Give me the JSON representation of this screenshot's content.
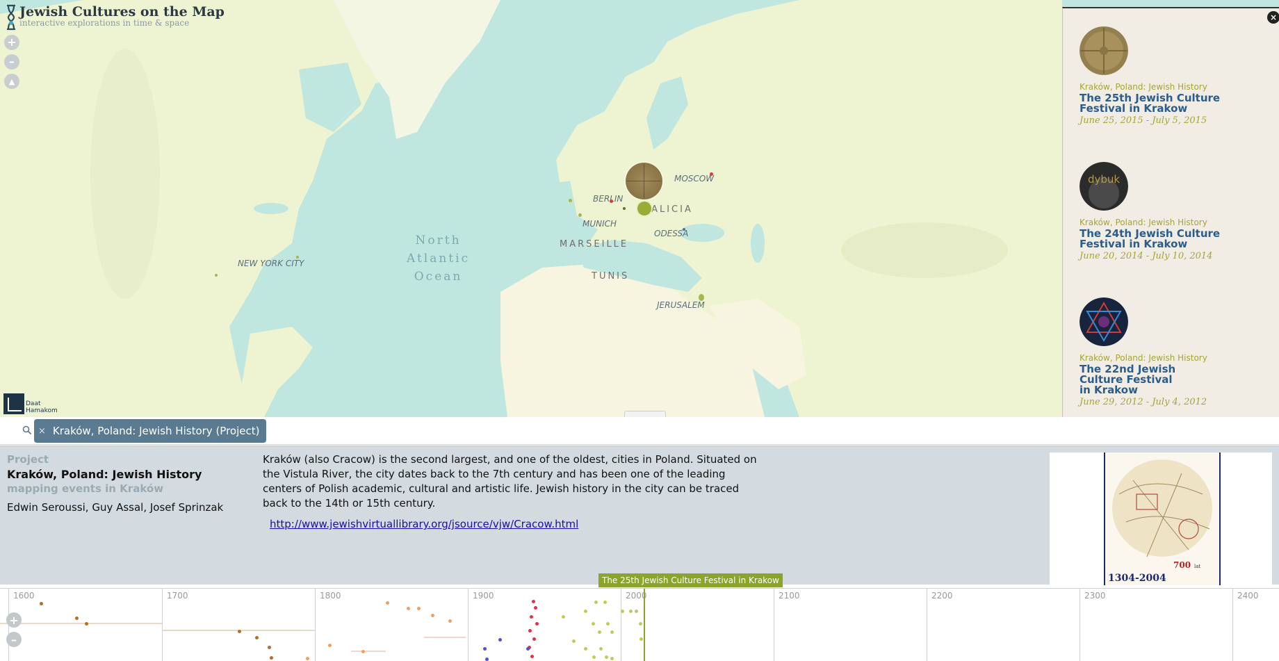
{
  "app": {
    "title": "Jewish Cultures on the Map",
    "subtitle": "interactive explorations in time & space",
    "partner": [
      "Daat",
      "Hamakom"
    ]
  },
  "map": {
    "controls": {
      "zoom_in": "+",
      "zoom_out": "–",
      "north": "▲"
    },
    "ocean_label": "North\nAtlantic\nOcean",
    "cities": [
      "BERLIN",
      "MOSCOW",
      "MUNICH",
      "ODESSA",
      "NEW YORK CITY",
      "JERUSALEM"
    ],
    "regions": [
      "GALICIA",
      "MARSEILLE",
      "TUNIS"
    ],
    "colors": {
      "ocean": "#bfe6df",
      "land": "#eef3d1",
      "desert": "#f7f5df",
      "marker_brown": "#8b7445",
      "marker_green": "#9aab3a"
    }
  },
  "events_panel": {
    "close_label": "×",
    "items": [
      {
        "category": "Kraków, Poland: Jewish History",
        "title": "The 25th Jewish Culture Festival in Krakow",
        "dates": "June 25, 2015 - July 5, 2015",
        "thumb": "compass-rose"
      },
      {
        "category": "Kraków, Poland: Jewish History",
        "title": "The 24th Jewish Culture Festival in Krakow",
        "dates": "June 20, 2014 - July 10, 2014",
        "thumb": "dybuk",
        "thumb_text": "dybuk"
      },
      {
        "category": "Kraków, Poland: Jewish History",
        "title": "The 22nd Jewish Culture Festival in Krakow",
        "dates": "June 29, 2012 - July 4, 2012",
        "thumb": "star-pattern"
      }
    ]
  },
  "filter": {
    "tag_label": "Kraków, Poland: Jewish History (Project)",
    "tag_remove": "×"
  },
  "project": {
    "type_label": "Project",
    "name": "Kraków, Poland: Jewish History",
    "subtitle": "mapping events in Kraków",
    "authors": "Edwin Seroussi, Guy Assal, Josef Sprinzak",
    "description": "Kraków (also Cracow) is the second largest, and one of the oldest, cities in Poland. Situated on the Vistula River, the city dates back to the 7th century and has been one of the leading centers of Polish academic, cultural and artistic life. Jewish history in the city can be traced back to the 14th or 15th century.",
    "link": "http://www.jewishvirtuallibrary.org/jsource/vjw/Cracow.html",
    "poster": {
      "years": "1304-2004",
      "big_number": "700",
      "small_text": "lat"
    }
  },
  "timeline": {
    "years": [
      "1600",
      "1700",
      "1800",
      "1900",
      "2000",
      "2100",
      "2200",
      "2300",
      "2400"
    ],
    "tooltip": "The 25th Jewish Culture Festival in Krakow",
    "zoom_in": "+",
    "zoom_out": "–"
  }
}
